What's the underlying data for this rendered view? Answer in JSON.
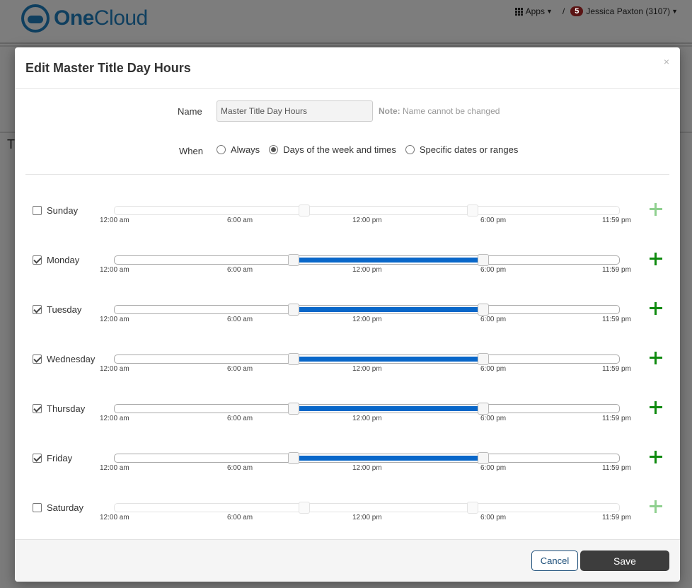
{
  "app": {
    "logo_text_one": "One",
    "logo_text_cloud": "Cloud",
    "apps_label": "Apps",
    "separator": "/",
    "notification_count": "5",
    "user_label": "Jessica Paxton (3107)",
    "background_text": "T"
  },
  "modal": {
    "title": "Edit Master Title Day Hours",
    "close_label": "×",
    "name_label": "Name",
    "name_value": "Master Title Day Hours",
    "note_label": "Note:",
    "note_text": "Name cannot be changed",
    "when_label": "When",
    "when_options": [
      {
        "label": "Always",
        "checked": false
      },
      {
        "label": "Days of the week and times",
        "checked": true
      },
      {
        "label": "Specific dates or ranges",
        "checked": false
      }
    ],
    "tick_labels": [
      "12:00 am",
      "6:00 am",
      "12:00 pm",
      "6:00 pm",
      "11:59 pm"
    ],
    "days": [
      {
        "name": "Sunday",
        "checked": false,
        "start": "9:00 am",
        "end": "5:00 pm",
        "start_fraction": 0.375,
        "end_fraction": 0.708
      },
      {
        "name": "Monday",
        "checked": true,
        "start": "8:30 am",
        "end": "5:30 pm",
        "start_fraction": 0.354,
        "end_fraction": 0.729
      },
      {
        "name": "Tuesday",
        "checked": true,
        "start": "8:30 am",
        "end": "5:30 pm",
        "start_fraction": 0.354,
        "end_fraction": 0.729
      },
      {
        "name": "Wednesday",
        "checked": true,
        "start": "8:30 am",
        "end": "5:30 pm",
        "start_fraction": 0.354,
        "end_fraction": 0.729
      },
      {
        "name": "Thursday",
        "checked": true,
        "start": "8:30 am",
        "end": "5:30 pm",
        "start_fraction": 0.354,
        "end_fraction": 0.729
      },
      {
        "name": "Friday",
        "checked": true,
        "start": "8:30 am",
        "end": "5:30 pm",
        "start_fraction": 0.354,
        "end_fraction": 0.729
      },
      {
        "name": "Saturday",
        "checked": false,
        "start": "9:00 am",
        "end": "5:00 pm",
        "start_fraction": 0.375,
        "end_fraction": 0.708
      }
    ],
    "cancel_label": "Cancel",
    "save_label": "Save"
  },
  "colors": {
    "range_fill": "#0967c9",
    "add_icon": "#0e8a0e",
    "add_icon_disabled": "#8fd08f",
    "save_button": "#3d3d3d",
    "cancel_border": "#1d4f7a"
  }
}
